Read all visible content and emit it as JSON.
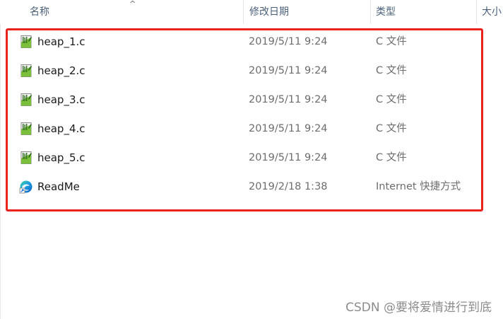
{
  "columns": {
    "name": "名称",
    "date": "修改日期",
    "type": "类型",
    "size": "大小"
  },
  "sort_indicator": "^",
  "files": [
    {
      "name": "heap_1.c",
      "date": "2019/5/11 9:24",
      "type": "C 文件",
      "icon": "c-source-file-icon"
    },
    {
      "name": "heap_2.c",
      "date": "2019/5/11 9:24",
      "type": "C 文件",
      "icon": "c-source-file-icon"
    },
    {
      "name": "heap_3.c",
      "date": "2019/5/11 9:24",
      "type": "C 文件",
      "icon": "c-source-file-icon"
    },
    {
      "name": "heap_4.c",
      "date": "2019/5/11 9:24",
      "type": "C 文件",
      "icon": "c-source-file-icon"
    },
    {
      "name": "heap_5.c",
      "date": "2019/5/11 9:24",
      "type": "C 文件",
      "icon": "c-source-file-icon"
    },
    {
      "name": "ReadMe",
      "date": "2019/2/18 1:38",
      "type": "Internet 快捷方式",
      "icon": "edge-shortcut-icon"
    }
  ],
  "colors": {
    "highlight": "#e8231f",
    "header_text": "#4c607a",
    "secondary_text": "#6d6d6d"
  },
  "watermark": "CSDN @要将爱情进行到底"
}
